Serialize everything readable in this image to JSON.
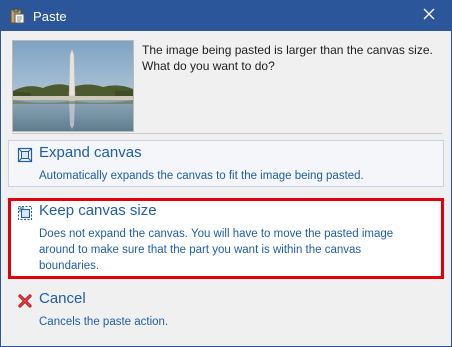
{
  "window": {
    "title": "Paste",
    "accent": "#2b579a",
    "close_icon": "close-icon",
    "app_icon": "clipboard-icon"
  },
  "header": {
    "message_line1": "The image being pasted is larger than the canvas size.",
    "message_line2": "What do you want to do?",
    "thumbnail_icon": "image-thumbnail"
  },
  "options": {
    "expand": {
      "title": "Expand canvas",
      "description": "Automatically expands the canvas to fit the image being pasted.",
      "icon": "expand-canvas-icon"
    },
    "keep": {
      "title": "Keep canvas size",
      "description_line1": "Does not expand the canvas. You will have to move the pasted image",
      "description_line2": "around to make sure that the part you want is within the canvas",
      "description_line3": "boundaries.",
      "icon": "keep-canvas-icon",
      "highlight_color": "#e0000d"
    },
    "cancel": {
      "title": "Cancel",
      "description": "Cancels the paste action.",
      "icon": "red-x-icon"
    }
  },
  "colors": {
    "link_text": "#1f5ea8",
    "body_text": "#1e1e1e",
    "background": "#f0f0f0"
  }
}
